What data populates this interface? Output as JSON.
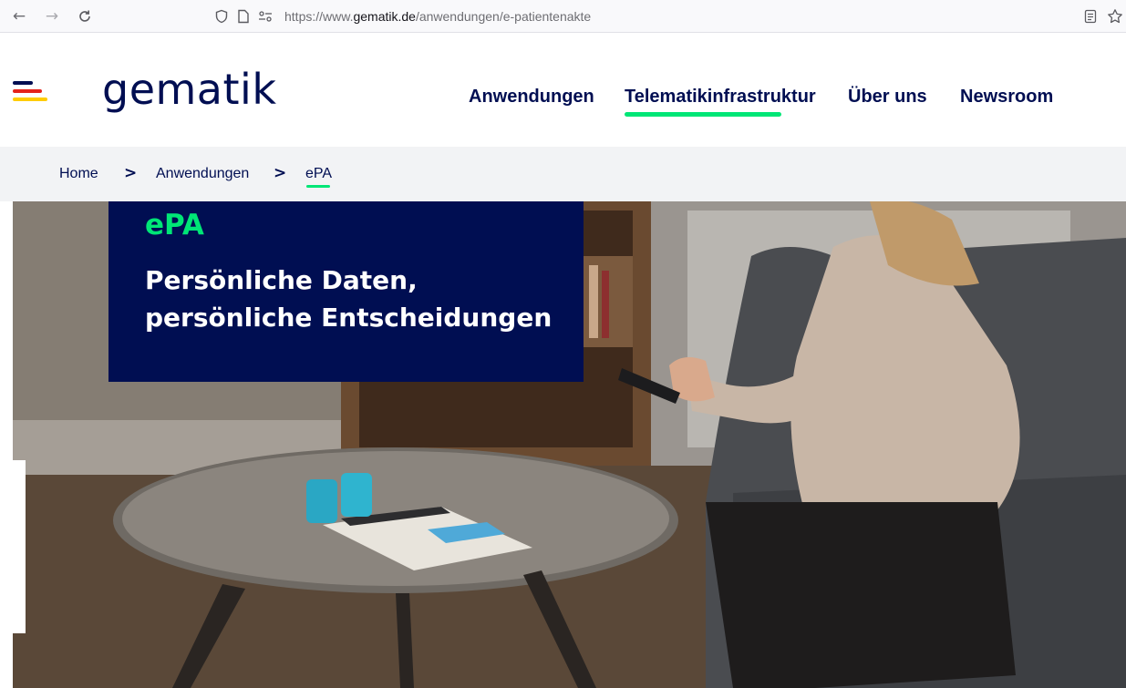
{
  "browser": {
    "back_icon": "←",
    "forward_icon": "→",
    "reload_icon": "C",
    "url_prefix": "https://www.",
    "url_domain": "gematik.de",
    "url_path": "/anwendungen/e-patientenakte",
    "icons": [
      "shield-icon",
      "page-icon",
      "permissions-icon",
      "reader-view-icon",
      "bookmark-star-icon"
    ]
  },
  "header": {
    "logo_text": "gematik",
    "nav": [
      {
        "label": "Anwendungen"
      },
      {
        "label": "Telematikinfrastruktur",
        "active": true
      },
      {
        "label": "Über uns"
      },
      {
        "label": "Newsroom"
      }
    ],
    "menu_colors": [
      "#000e52",
      "#e5231b",
      "#ffcc00"
    ]
  },
  "breadcrumb": {
    "items": [
      "Home",
      "Anwendungen",
      "ePA"
    ],
    "separator": ">"
  },
  "hero": {
    "kicker": "ePA",
    "title_line1": "Persönliche Daten,",
    "title_line2": "persönliche Entscheidungen"
  },
  "colors": {
    "brand_navy": "#000e52",
    "accent_green": "#00e676",
    "breadcrumb_bg": "#f2f3f5"
  }
}
